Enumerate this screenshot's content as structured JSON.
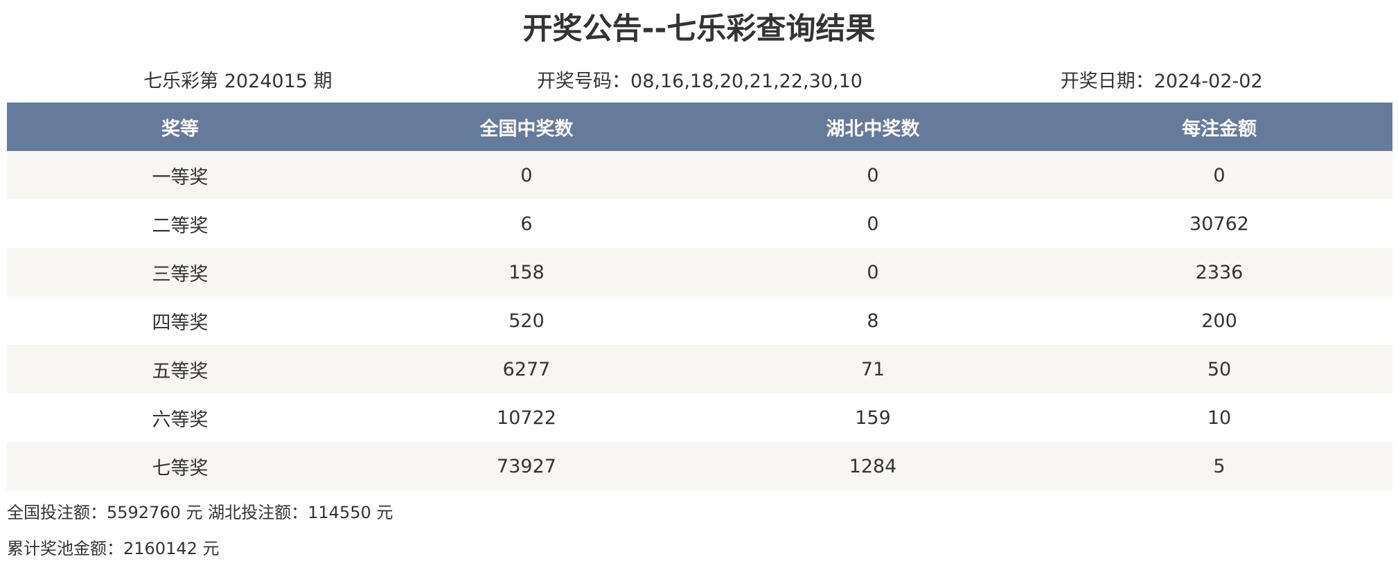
{
  "page": {
    "title": "开奖公告--七乐彩查询结果"
  },
  "info": {
    "issue": "七乐彩第 2024015 期",
    "numbers": "开奖号码：08,16,18,20,21,22,30,10",
    "date": "开奖日期：2024-02-02"
  },
  "table": {
    "headers": [
      "奖等",
      "全国中奖数",
      "湖北中奖数",
      "每注金额"
    ],
    "rows": [
      [
        "一等奖",
        "0",
        "0",
        "0"
      ],
      [
        "二等奖",
        "6",
        "0",
        "30762"
      ],
      [
        "三等奖",
        "158",
        "0",
        "2336"
      ],
      [
        "四等奖",
        "520",
        "8",
        "200"
      ],
      [
        "五等奖",
        "6277",
        "71",
        "50"
      ],
      [
        "六等奖",
        "10722",
        "159",
        "10"
      ],
      [
        "七等奖",
        "73927",
        "1284",
        "5"
      ]
    ]
  },
  "footer": {
    "sales": "全国投注额：5592760 元 湖北投注额：114550 元",
    "pool": "累计奖池金额：2160142 元"
  },
  "colors": {
    "header_bg": "#657b9c",
    "row_alt_bg": "#f7f6f2",
    "text": "#333333"
  }
}
